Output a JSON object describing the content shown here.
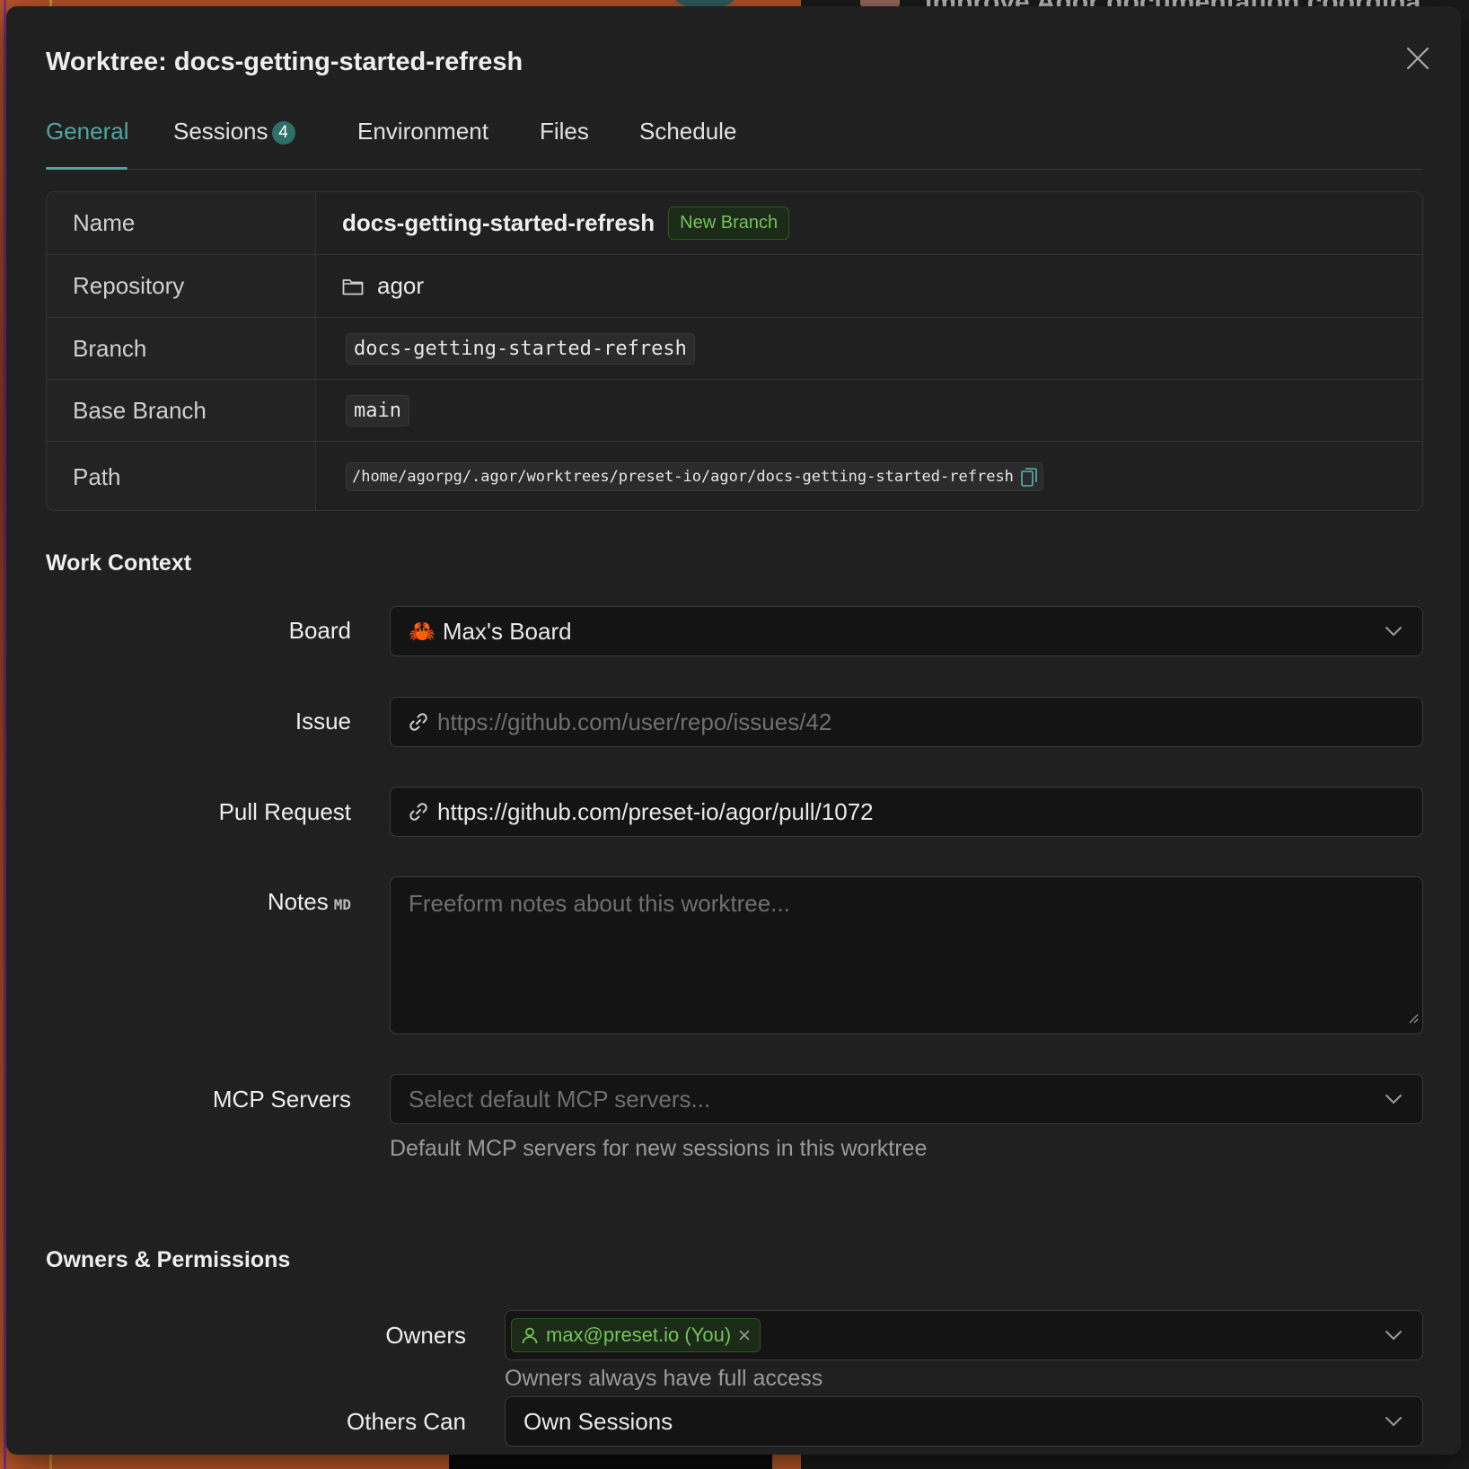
{
  "background": {
    "headline": "improve Agor documentation coordina"
  },
  "modal": {
    "title": "Worktree: docs-getting-started-refresh",
    "close_icon": "close-icon"
  },
  "tabs": [
    {
      "label": "General",
      "active": true
    },
    {
      "label": "Sessions",
      "badge": "4"
    },
    {
      "label": "Environment"
    },
    {
      "label": "Files"
    },
    {
      "label": "Schedule"
    }
  ],
  "details": {
    "name": {
      "label": "Name",
      "value": "docs-getting-started-refresh",
      "tag": "New Branch"
    },
    "repository": {
      "label": "Repository",
      "value": "agor",
      "icon": "folder-icon"
    },
    "branch": {
      "label": "Branch",
      "value": "docs-getting-started-refresh"
    },
    "base_branch": {
      "label": "Base Branch",
      "value": "main"
    },
    "path": {
      "label": "Path",
      "value": "/home/agorpg/.agor/worktrees/preset-io/agor/docs-getting-started-refresh",
      "icon": "copy-icon"
    }
  },
  "work_context": {
    "title": "Work Context",
    "board": {
      "label": "Board",
      "emoji": "🦀",
      "value": "Max's Board"
    },
    "issue": {
      "label": "Issue",
      "placeholder": "https://github.com/user/repo/issues/42",
      "value": ""
    },
    "pull_request": {
      "label": "Pull Request",
      "value": "https://github.com/preset-io/agor/pull/1072"
    },
    "notes": {
      "label": "Notes",
      "badge": "MD",
      "placeholder": "Freeform notes about this worktree..."
    },
    "mcp_servers": {
      "label": "MCP Servers",
      "placeholder": "Select default MCP servers...",
      "helper": "Default MCP servers for new sessions in this worktree"
    }
  },
  "owners_permissions": {
    "title": "Owners & Permissions",
    "owners": {
      "label": "Owners",
      "tag": "max@preset.io (You)",
      "helper": "Owners always have full access"
    },
    "others_can": {
      "label": "Others Can",
      "value": "Own Sessions"
    }
  },
  "colors": {
    "accent": "#4fa6a1",
    "tag_green": "#74c25b",
    "modal_bg": "#202020"
  }
}
